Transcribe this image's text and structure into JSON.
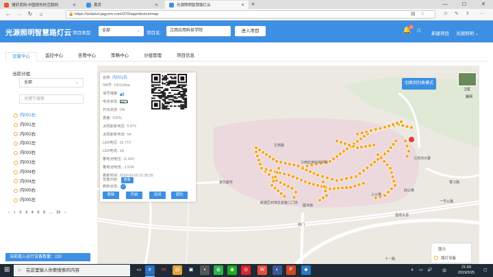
{
  "browser": {
    "tabs": [
      {
        "title": "搜好货网-中国领先的互联网",
        "active": false,
        "favicon_color": "#e8542c"
      },
      {
        "title": "首页",
        "active": false,
        "favicon_color": "#3d8fe3"
      },
      {
        "title": "光源照明智慧路灯云",
        "active": true,
        "favicon_color": "#3d8fe3"
      }
    ],
    "new_tab": "+",
    "url": "https://solariot.jagyzm.com/370/app/device/map",
    "window_controls": [
      "—",
      "☐",
      "✕"
    ]
  },
  "header": {
    "brand": "光源照明智慧路灯云",
    "project_type_label": "项目类型:",
    "project_type_value": "全部",
    "project_name_label": "项目名:",
    "project_name_value": "江西应用科技学院",
    "enter_button": "进入项目",
    "notification_count": "2",
    "new_project": "新建项目",
    "user_name": "光源照明",
    "accent_color": "#3d8fe3"
  },
  "nav_tabs": [
    "设备中心",
    "监控中心",
    "告警中心",
    "策略中心",
    "分组管理",
    "项目信息"
  ],
  "left_panel": {
    "group_title": "当前分组:",
    "group_value": "全部",
    "search_placeholder": "关键字搜索",
    "devices": [
      "内001右",
      "内001左",
      "内002右",
      "内002左",
      "内003右",
      "内003左",
      "内004右",
      "内004左",
      "内005右",
      "内005左"
    ],
    "selected_device": 0,
    "pages": [
      "‹",
      "1",
      "2",
      "3",
      "4",
      "5",
      "6",
      "...",
      "22",
      "›"
    ],
    "current_page": "1",
    "online_count": "当前接入运行设备数量：220"
  },
  "info_card": {
    "rows": [
      {
        "label": "名称:",
        "value": "内001右"
      },
      {
        "label": "SN号:",
        "value": "100109ea"
      },
      {
        "label": "信号强度:",
        "value": ""
      },
      {
        "label": "电池状态:",
        "value": ""
      },
      {
        "label": "开关状态:",
        "value": "ON"
      },
      {
        "label": "亮度:",
        "value": "100%"
      },
      {
        "label": "太阳能板电压:",
        "value": "0.07V"
      },
      {
        "label": "太阳能板电流:",
        "value": "0A"
      },
      {
        "label": "LED电压:",
        "value": "16.77V"
      },
      {
        "label": "LED电流:",
        "value": "1A"
      },
      {
        "label": "蓄电池电压:",
        "value": "11.64V"
      },
      {
        "label": "蓄电池电流:",
        "value": "-1.52A"
      },
      {
        "label": "刷新时间:",
        "value": "2019-03-25 21:35:35"
      },
      {
        "label": "告警内容:",
        "value": ""
      },
      {
        "label": "刷新状态:",
        "value": ""
      }
    ],
    "view_button": "查看",
    "actions": [
      "更新",
      "开启",
      "关闭",
      "调光"
    ]
  },
  "map": {
    "switch_button": "切换到列表模式",
    "satellite_label": "卫星",
    "roadnet_label": "路网",
    "legend_title": "图示",
    "legend_item": "路灯设备",
    "place_labels": [
      "江西应用科技学院",
      "家乐超市",
      "新建区石埠生资第二门市",
      "南门",
      "昌南大道",
      "江苏鸿大厦",
      "文苑路",
      "图书馆",
      "三公寓",
      "四公寓",
      "一号公路",
      "香江路",
      "十一路"
    ],
    "lamp_color": "#f5a623"
  },
  "taskbar": {
    "search_placeholder": "在这里输入你要搜索的内容",
    "time": "21:59",
    "date": "2019/3/25",
    "lang": "中",
    "tray_icons": [
      "∧",
      "▭",
      "🔊"
    ]
  }
}
